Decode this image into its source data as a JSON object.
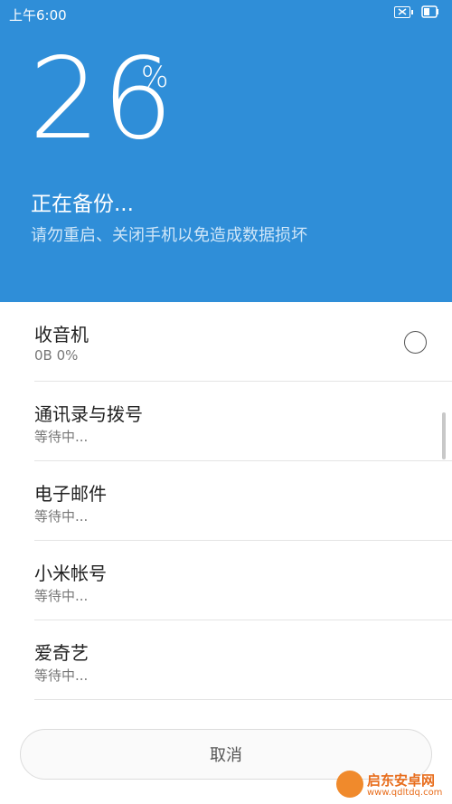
{
  "status_bar": {
    "time": "上午6:00"
  },
  "header": {
    "percent": "26",
    "percent_sign": "%",
    "title": "正在备份...",
    "subtitle": "请勿重启、关闭手机以免造成数据损坏"
  },
  "items": [
    {
      "title": "收音机",
      "status": "0B 0%"
    },
    {
      "title": "通讯录与拨号",
      "status": "等待中..."
    },
    {
      "title": "电子邮件",
      "status": "等待中..."
    },
    {
      "title": "小米帐号",
      "status": "等待中..."
    },
    {
      "title": "爱奇艺",
      "status": "等待中..."
    }
  ],
  "footer": {
    "cancel_label": "取消"
  },
  "watermark": {
    "title": "启东安卓网",
    "url": "www.qdltdq.com"
  },
  "colors": {
    "header_bg": "#2f8ed8",
    "watermark": "#e86d1c"
  }
}
